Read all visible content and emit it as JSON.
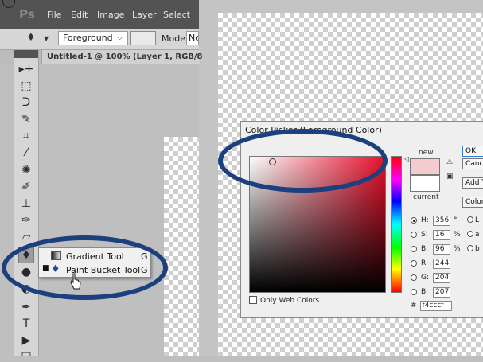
{
  "menubar": {
    "logo": "Ps",
    "items": [
      "File",
      "Edit",
      "Image",
      "Layer",
      "Select"
    ]
  },
  "options_bar": {
    "fill_source": "Foreground",
    "mode_label": "Mode:",
    "mode_value": "No"
  },
  "document_tab": {
    "title": "Untitled-1 @ 100% (Layer 1, RGB/8"
  },
  "toolbox": {
    "tools": [
      {
        "name": "move-tool",
        "glyph": "▸+"
      },
      {
        "name": "marquee-tool",
        "glyph": "⬚"
      },
      {
        "name": "lasso-tool",
        "glyph": "ᑐ"
      },
      {
        "name": "quick-selection-tool",
        "glyph": "✎"
      },
      {
        "name": "crop-tool",
        "glyph": "⌗"
      },
      {
        "name": "eyedropper-tool",
        "glyph": "⁄"
      },
      {
        "name": "spot-healing-tool",
        "glyph": "✺"
      },
      {
        "name": "brush-tool",
        "glyph": "✐"
      },
      {
        "name": "clone-stamp-tool",
        "glyph": "⊥"
      },
      {
        "name": "history-brush-tool",
        "glyph": "✑"
      },
      {
        "name": "eraser-tool",
        "glyph": "▱"
      },
      {
        "name": "paint-bucket-tool",
        "glyph": "♦"
      },
      {
        "name": "blur-tool",
        "glyph": "●"
      },
      {
        "name": "dodge-tool",
        "glyph": "◐"
      },
      {
        "name": "pen-tool",
        "glyph": "✒"
      },
      {
        "name": "type-tool",
        "glyph": "T"
      },
      {
        "name": "path-selection-tool",
        "glyph": "▶"
      },
      {
        "name": "shape-tool",
        "glyph": "▭"
      }
    ]
  },
  "flyout": {
    "items": [
      {
        "label": "Gradient Tool",
        "shortcut": "G",
        "selected": false
      },
      {
        "label": "Paint Bucket Tool",
        "shortcut": "G",
        "selected": true
      }
    ]
  },
  "color_picker": {
    "title": "Color Picker (Foreground Color)",
    "new_label": "new",
    "current_label": "current",
    "new_color": "#f4cccf",
    "current_color": "#ffffff",
    "hue_color": "#e8102a",
    "buttons": {
      "ok": "OK",
      "reset": "Cancel",
      "add_swatch": "Add To Swatches",
      "color_libraries": "Color Libraries"
    },
    "hsb": [
      {
        "label": "H:",
        "value": "356",
        "unit": "°",
        "selected": true
      },
      {
        "label": "S:",
        "value": "16",
        "unit": "%",
        "selected": false
      },
      {
        "label": "B:",
        "value": "96",
        "unit": "%",
        "selected": false
      }
    ],
    "rgb": [
      {
        "label": "R:",
        "value": "244"
      },
      {
        "label": "G:",
        "value": "204"
      },
      {
        "label": "B:",
        "value": "207"
      }
    ],
    "lab": [
      "L",
      "a",
      "b"
    ],
    "only_web_colors": "Only Web Colors",
    "hex_prefix": "#",
    "hex": "f4cccf"
  },
  "annotation_color": "#1c3f7d"
}
